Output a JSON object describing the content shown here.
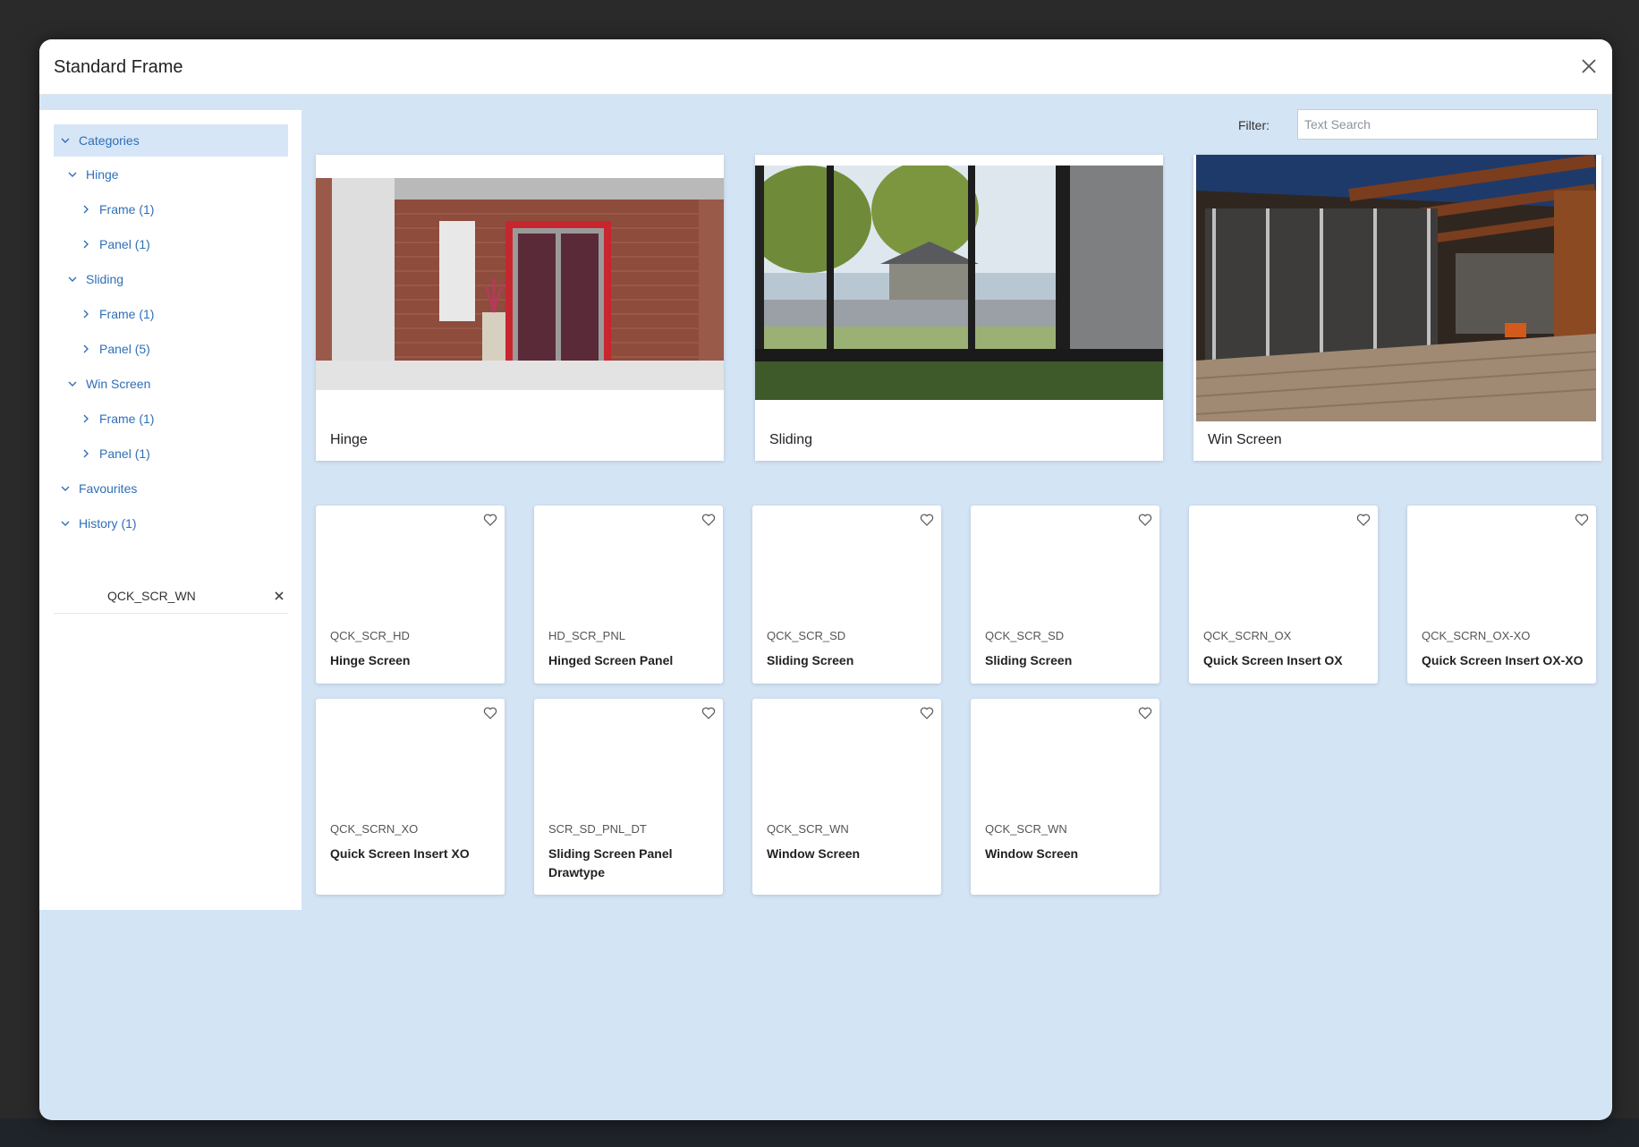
{
  "dialog": {
    "title": "Standard Frame"
  },
  "sidebar": {
    "categories_label": "Categories",
    "groups": [
      {
        "label": "Hinge",
        "children": [
          "Frame (1)",
          "Panel (1)"
        ]
      },
      {
        "label": "Sliding",
        "children": [
          "Frame (1)",
          "Panel (5)"
        ]
      },
      {
        "label": "Win Screen",
        "children": [
          "Frame (1)",
          "Panel (1)"
        ]
      }
    ],
    "favourites_label": "Favourites",
    "history_label": "History (1)",
    "history_items": [
      "QCK_SCR_WN"
    ]
  },
  "filter": {
    "label": "Filter:",
    "placeholder": "Text Search",
    "value": ""
  },
  "category_cards": [
    {
      "label": "Hinge"
    },
    {
      "label": "Sliding"
    },
    {
      "label": "Win Screen"
    }
  ],
  "products": [
    {
      "code": "QCK_SCR_HD",
      "name": "Hinge Screen"
    },
    {
      "code": "HD_SCR_PNL",
      "name": "Hinged Screen Panel"
    },
    {
      "code": "QCK_SCR_SD",
      "name": "Sliding Screen"
    },
    {
      "code": "QCK_SCR_SD",
      "name": "Sliding Screen"
    },
    {
      "code": "QCK_SCRN_OX",
      "name": "Quick Screen Insert OX"
    },
    {
      "code": "QCK_SCRN_OX-XO",
      "name": "Quick Screen Insert OX-XO"
    },
    {
      "code": "QCK_SCRN_XO",
      "name": "Quick Screen Insert XO"
    },
    {
      "code": "SCR_SD_PNL_DT",
      "name": "Sliding Screen Panel Drawtype"
    },
    {
      "code": "QCK_SCR_WN",
      "name": "Window Screen"
    },
    {
      "code": "QCK_SCR_WN",
      "name": "Window Screen"
    }
  ],
  "colors": {
    "accent": "#2f6fb7",
    "modal_bg": "#d3e4f5",
    "selected_row": "#d6e6f7"
  },
  "icons": {
    "close": "close-icon",
    "expand": "chevron-down-icon",
    "collapsed": "chevron-right-icon",
    "favourite": "heart-outline-icon",
    "remove": "x-icon"
  }
}
